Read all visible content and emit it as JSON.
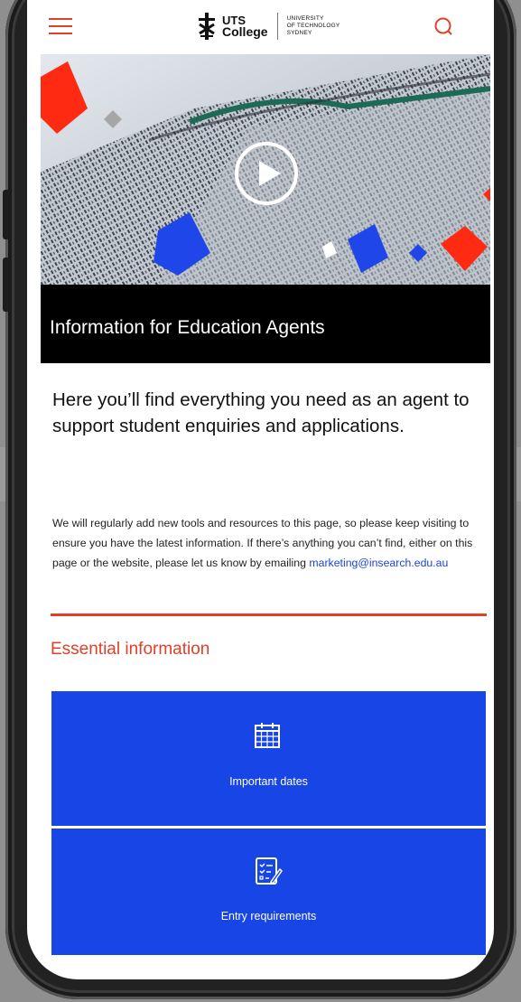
{
  "header": {
    "logo_line1": "UTS",
    "logo_line2": "College",
    "logo_univ_1": "UNIVERSITY",
    "logo_univ_2": "OF TECHNOLOGY",
    "logo_univ_3": "SYDNEY"
  },
  "hero": {
    "title": "Information for Education Agents"
  },
  "content": {
    "lead": "Here you’ll find everything you need as an agent to support student enquiries and applications.",
    "body": "We will regularly add new tools and resources to this page, so please keep visiting to ensure you have the latest information. If there’s anything you can’t find, either on this page or the website, please let us know by emailing ",
    "email": "marketing@insearch.edu.au"
  },
  "essential": {
    "title": "Essential information",
    "tiles": [
      {
        "label": "Important dates",
        "icon": "calendar-icon"
      },
      {
        "label": "Entry requirements",
        "icon": "checklist-icon"
      }
    ]
  },
  "colors": {
    "accent_red": "#e0402a",
    "tile_blue": "#1745e6",
    "link_blue": "#1a44d6"
  }
}
